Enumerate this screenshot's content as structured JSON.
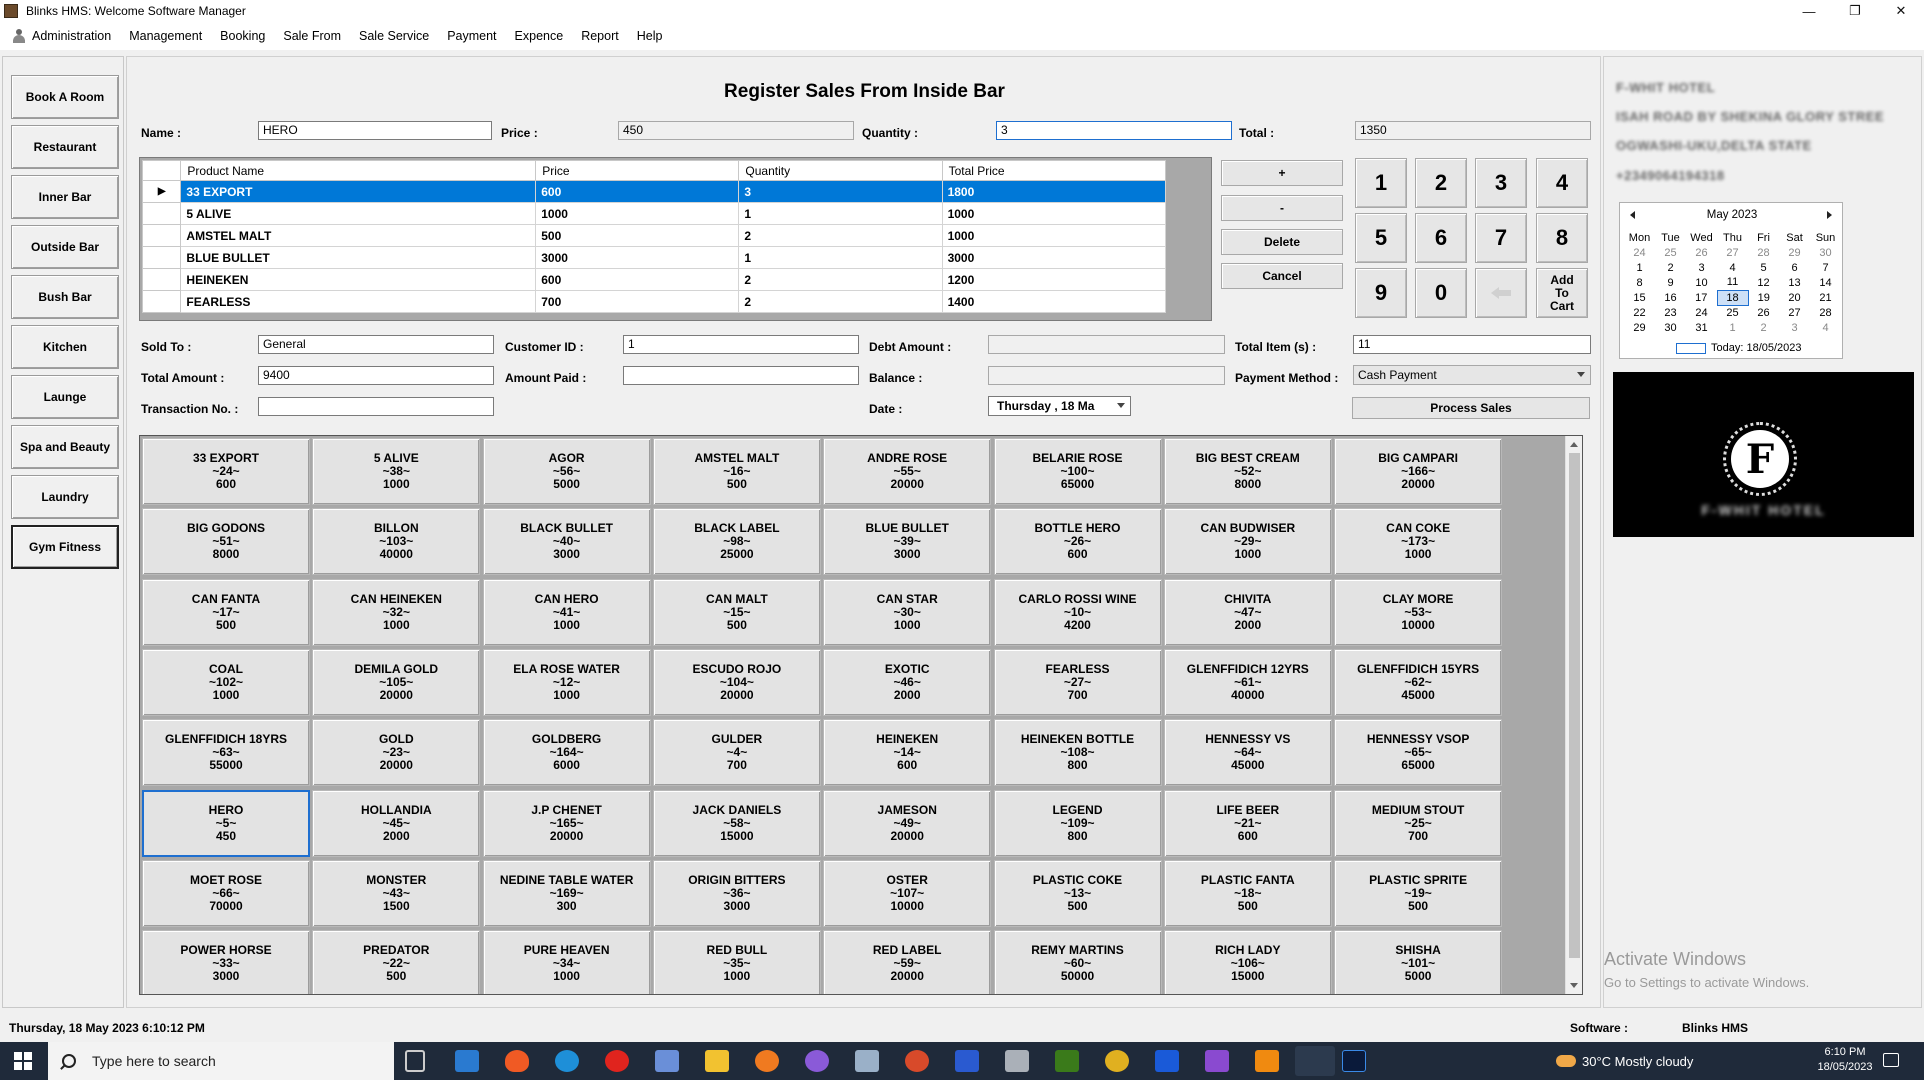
{
  "window": {
    "title": "Blinks HMS: Welcome Software Manager",
    "controls": [
      "—",
      "❐",
      "✕"
    ]
  },
  "menu": [
    "Administration",
    "Management",
    "Booking",
    "Sale From",
    "Sale Service",
    "Payment",
    "Expence",
    "Report",
    "Help"
  ],
  "sidebar": {
    "items": [
      {
        "label": "Book A Room"
      },
      {
        "label": "Restaurant"
      },
      {
        "label": "Inner Bar"
      },
      {
        "label": "Outside Bar"
      },
      {
        "label": "Bush Bar"
      },
      {
        "label": "Kitchen"
      },
      {
        "label": "Launge"
      },
      {
        "label": "Spa and Beauty"
      },
      {
        "label": "Laundry"
      },
      {
        "label": "Gym  Fitness"
      }
    ]
  },
  "form": {
    "title": "Register Sales From Inside Bar",
    "name_label": "Name :",
    "name_value": "HERO",
    "price_label": "Price :",
    "price_value": "450",
    "quantity_label": "Quantity :",
    "quantity_value": "3",
    "total_label": "Total :",
    "total_value": "1350",
    "sold_to_label": "Sold To :",
    "sold_to_value": "General",
    "customer_id_label": "Customer ID :",
    "customer_id_value": "1",
    "debt_amount_label": "Debt Amount :",
    "debt_amount_value": "",
    "total_items_label": "Total Item (s) :",
    "total_items_value": "11",
    "total_amount_label": "Total Amount :",
    "total_amount_value": "9400",
    "amount_paid_label": "Amount Paid :",
    "amount_paid_value": "",
    "balance_label": "Balance :",
    "balance_value": "",
    "payment_method_label": "Payment Method :",
    "payment_method_value": "Cash Payment",
    "transaction_label": "Transaction No. :",
    "transaction_value": "",
    "date_label": "Date :",
    "date_value": "Thursday ,  18     Ma",
    "process_button": "Process Sales"
  },
  "cart": {
    "headers": [
      "Product Name",
      "Price",
      "Quantity",
      "Total Price"
    ],
    "rows": [
      [
        "33 EXPORT",
        "600",
        "3",
        "1800"
      ],
      [
        "5 ALIVE",
        "1000",
        "1",
        "1000"
      ],
      [
        "AMSTEL MALT",
        "500",
        "2",
        "1000"
      ],
      [
        "BLUE BULLET",
        "3000",
        "1",
        "3000"
      ],
      [
        "HEINEKEN",
        "600",
        "2",
        "1200"
      ],
      [
        "FEARLESS",
        "700",
        "2",
        "1400"
      ]
    ],
    "selected_row": 0,
    "row_marker": "▶"
  },
  "actions": {
    "plus": "+",
    "minus": "-",
    "delete": "Delete",
    "cancel": "Cancel"
  },
  "numpad": {
    "keys": [
      "1",
      "2",
      "3",
      "4",
      "5",
      "6",
      "7",
      "8",
      "9",
      "0"
    ],
    "add_to_cart": "Add To Cart"
  },
  "products": [
    {
      "name": "33 EXPORT",
      "code": "~24~",
      "price": "600"
    },
    {
      "name": "5 ALIVE",
      "code": "~38~",
      "price": "1000"
    },
    {
      "name": "AGOR",
      "code": "~56~",
      "price": "5000"
    },
    {
      "name": "AMSTEL MALT",
      "code": "~16~",
      "price": "500"
    },
    {
      "name": "ANDRE ROSE",
      "code": "~55~",
      "price": "20000"
    },
    {
      "name": "BELARIE ROSE",
      "code": "~100~",
      "price": "65000"
    },
    {
      "name": "BIG BEST CREAM",
      "code": "~52~",
      "price": "8000"
    },
    {
      "name": "BIG CAMPARI",
      "code": "~166~",
      "price": "20000"
    },
    {
      "name": "BIG GODONS",
      "code": "~51~",
      "price": "8000"
    },
    {
      "name": "BILLON",
      "code": "~103~",
      "price": "40000"
    },
    {
      "name": "BLACK BULLET",
      "code": "~40~",
      "price": "3000"
    },
    {
      "name": "BLACK LABEL",
      "code": "~98~",
      "price": "25000"
    },
    {
      "name": "BLUE BULLET",
      "code": "~39~",
      "price": "3000"
    },
    {
      "name": "BOTTLE HERO",
      "code": "~26~",
      "price": "600"
    },
    {
      "name": "CAN BUDWISER",
      "code": "~29~",
      "price": "1000"
    },
    {
      "name": "CAN COKE",
      "code": "~173~",
      "price": "1000"
    },
    {
      "name": "CAN FANTA",
      "code": "~17~",
      "price": "500"
    },
    {
      "name": "CAN HEINEKEN",
      "code": "~32~",
      "price": "1000"
    },
    {
      "name": "CAN HERO",
      "code": "~41~",
      "price": "1000"
    },
    {
      "name": "CAN MALT",
      "code": "~15~",
      "price": "500"
    },
    {
      "name": "CAN STAR",
      "code": "~30~",
      "price": "1000"
    },
    {
      "name": "CARLO ROSSI WINE",
      "code": "~10~",
      "price": "4200"
    },
    {
      "name": "CHIVITA",
      "code": "~47~",
      "price": "2000"
    },
    {
      "name": "CLAY MORE",
      "code": "~53~",
      "price": "10000"
    },
    {
      "name": "COAL",
      "code": "~102~",
      "price": "1000"
    },
    {
      "name": "DEMILA GOLD",
      "code": "~105~",
      "price": "20000"
    },
    {
      "name": "ELA ROSE WATER",
      "code": "~12~",
      "price": "1000"
    },
    {
      "name": "ESCUDO ROJO",
      "code": "~104~",
      "price": "20000"
    },
    {
      "name": "EXOTIC",
      "code": "~46~",
      "price": "2000"
    },
    {
      "name": "FEARLESS",
      "code": "~27~",
      "price": "700"
    },
    {
      "name": "GLENFFIDICH 12YRS",
      "code": "~61~",
      "price": "40000"
    },
    {
      "name": "GLENFFIDICH 15YRS",
      "code": "~62~",
      "price": "45000"
    },
    {
      "name": "GLENFFIDICH 18YRS",
      "code": "~63~",
      "price": "55000"
    },
    {
      "name": "GOLD",
      "code": "~23~",
      "price": "20000"
    },
    {
      "name": "GOLDBERG",
      "code": "~164~",
      "price": "6000"
    },
    {
      "name": "GULDER",
      "code": "~4~",
      "price": "700"
    },
    {
      "name": "HEINEKEN",
      "code": "~14~",
      "price": "600"
    },
    {
      "name": "HEINEKEN BOTTLE",
      "code": "~108~",
      "price": "800"
    },
    {
      "name": "HENNESSY VS",
      "code": "~64~",
      "price": "45000"
    },
    {
      "name": "HENNESSY VSOP",
      "code": "~65~",
      "price": "65000"
    },
    {
      "name": "HERO",
      "code": "~5~",
      "price": "450"
    },
    {
      "name": "HOLLANDIA",
      "code": "~45~",
      "price": "2000"
    },
    {
      "name": "J.P CHENET",
      "code": "~165~",
      "price": "20000"
    },
    {
      "name": "JACK DANIELS",
      "code": "~58~",
      "price": "15000"
    },
    {
      "name": "JAMESON",
      "code": "~49~",
      "price": "20000"
    },
    {
      "name": "LEGEND",
      "code": "~109~",
      "price": "800"
    },
    {
      "name": "LIFE  BEER",
      "code": "~21~",
      "price": "600"
    },
    {
      "name": "MEDIUM STOUT",
      "code": "~25~",
      "price": "700"
    },
    {
      "name": "MOET ROSE",
      "code": "~66~",
      "price": "70000"
    },
    {
      "name": "MONSTER",
      "code": "~43~",
      "price": "1500"
    },
    {
      "name": "NEDINE TABLE WATER",
      "code": "~169~",
      "price": "300"
    },
    {
      "name": "ORIGIN BITTERS",
      "code": "~36~",
      "price": "3000"
    },
    {
      "name": "OSTER",
      "code": "~107~",
      "price": "10000"
    },
    {
      "name": "PLASTIC COKE",
      "code": "~13~",
      "price": "500"
    },
    {
      "name": "PLASTIC FANTA",
      "code": "~18~",
      "price": "500"
    },
    {
      "name": "PLASTIC SPRITE",
      "code": "~19~",
      "price": "500"
    },
    {
      "name": "POWER HORSE",
      "code": "~33~",
      "price": "3000"
    },
    {
      "name": "PREDATOR",
      "code": "~22~",
      "price": "500"
    },
    {
      "name": "PURE HEAVEN",
      "code": "~34~",
      "price": "1000"
    },
    {
      "name": "RED BULL",
      "code": "~35~",
      "price": "1000"
    },
    {
      "name": "RED LABEL",
      "code": "~59~",
      "price": "20000"
    },
    {
      "name": "REMY MARTINS",
      "code": "~60~",
      "price": "50000"
    },
    {
      "name": "RICH LADY",
      "code": "~106~",
      "price": "15000"
    },
    {
      "name": "SHISHA",
      "code": "~101~",
      "price": "5000"
    }
  ],
  "selected_product": "HERO",
  "hotel": {
    "name": "F-WHIT HOTEL",
    "address1": "ISAH ROAD BY SHEKINA GLORY STREE",
    "address2": "OGWASHI-UKU,DELTA STATE",
    "phone": "+2349064194318",
    "logo_letter": "F",
    "logo_name": "F-WHIT HOTEL"
  },
  "calendar": {
    "month": "May 2023",
    "weekdays": [
      "Mon",
      "Tue",
      "Wed",
      "Thu",
      "Fri",
      "Sat",
      "Sun"
    ],
    "weeks": [
      [
        "24",
        "25",
        "26",
        "27",
        "28",
        "29",
        "30"
      ],
      [
        "1",
        "2",
        "3",
        "4",
        "5",
        "6",
        "7"
      ],
      [
        "8",
        "9",
        "10",
        "11",
        "12",
        "13",
        "14"
      ],
      [
        "15",
        "16",
        "17",
        "18",
        "19",
        "20",
        "21"
      ],
      [
        "22",
        "23",
        "24",
        "25",
        "26",
        "27",
        "28"
      ],
      [
        "29",
        "30",
        "31",
        "1",
        "2",
        "3",
        "4"
      ]
    ],
    "today_text": "Today: 18/05/2023"
  },
  "watermark": {
    "line1": "Activate Windows",
    "line2": "Go to Settings to activate Windows."
  },
  "status": {
    "datetime": "Thursday, 18 May 2023 6:10:12 PM",
    "software_label": "Software :",
    "software_value": "Blinks HMS"
  },
  "taskbar": {
    "search_placeholder": "Type here to search",
    "weather": "30°C  Mostly cloudy",
    "time": "6:10 PM",
    "date": "18/05/2023"
  },
  "colors": {
    "selection": "#0078d7",
    "focus_border": "#1e6fd0",
    "taskbar": "#1f2a3a"
  }
}
